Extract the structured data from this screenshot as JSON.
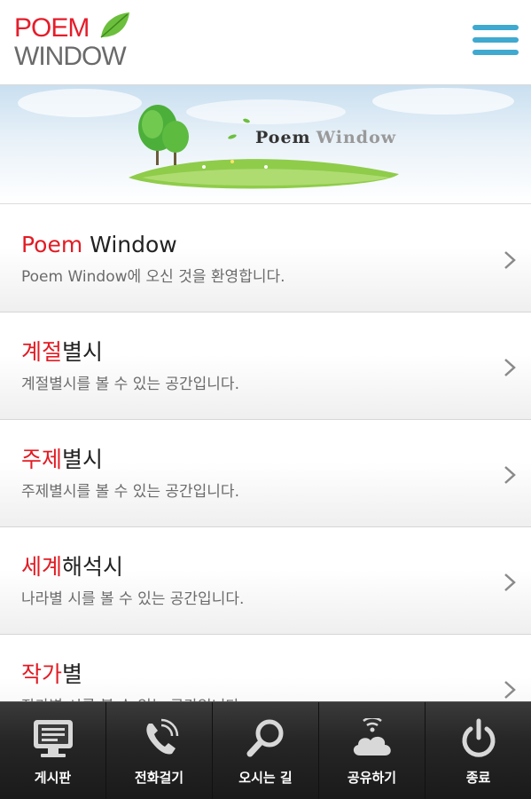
{
  "header": {
    "logo_line1": "POEM",
    "logo_line2": "WINDOW"
  },
  "banner": {
    "title_a": "Poem",
    "title_b": "Window"
  },
  "list": [
    {
      "title_red": "Poem",
      "title_black": " Window",
      "subtitle": "Poem Window에 오신 것을 환영합니다."
    },
    {
      "title_red": "계절",
      "title_black": "별시",
      "subtitle": "계절별시를 볼 수 있는 공간입니다."
    },
    {
      "title_red": "주제",
      "title_black": "별시",
      "subtitle": "주제별시를 볼 수 있는 공간입니다."
    },
    {
      "title_red": "세계",
      "title_black": "해석시",
      "subtitle": "나라별 시를 볼 수 있는 공간입니다."
    },
    {
      "title_red": "작가",
      "title_black": "별",
      "subtitle": "작가별 시를 볼 수 있는 공간입니다."
    }
  ],
  "bottom_nav": [
    {
      "label": "게시판",
      "icon": "monitor-icon"
    },
    {
      "label": "전화걸기",
      "icon": "phone-icon"
    },
    {
      "label": "오시는 길",
      "icon": "search-icon"
    },
    {
      "label": "공유하기",
      "icon": "cloud-share-icon"
    },
    {
      "label": "종료",
      "icon": "power-icon"
    }
  ],
  "colors": {
    "accent_red": "#e31b23",
    "menu_blue": "#3fa9d0",
    "nav_bg": "#262626"
  }
}
